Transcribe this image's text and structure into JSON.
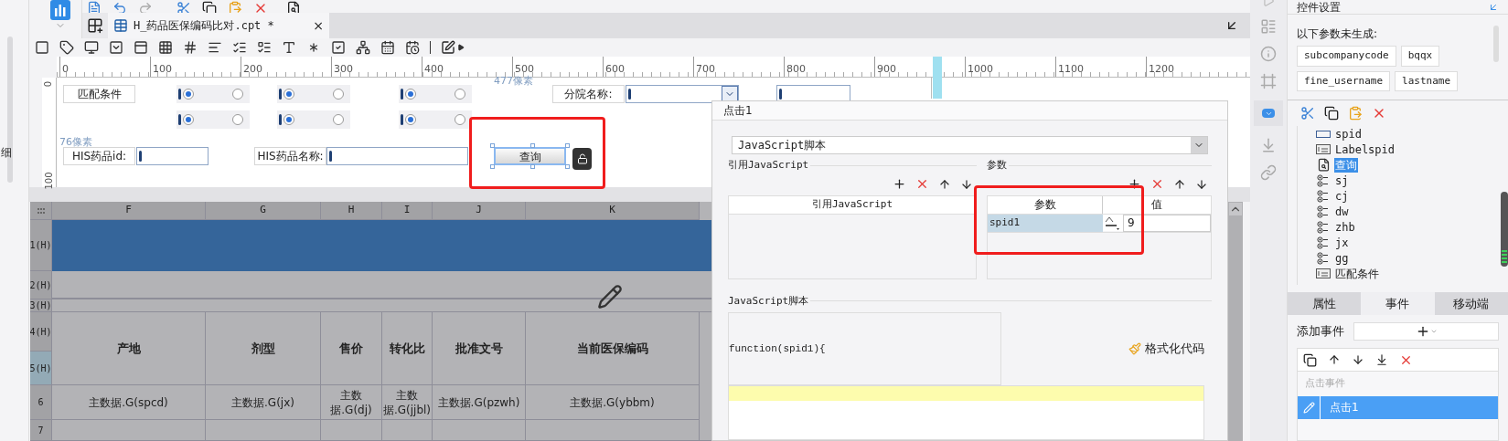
{
  "side": {
    "text": "细"
  },
  "editor_tab": {
    "title": "H_药品医保编码比对.cpt *",
    "close": "×"
  },
  "ruler": [
    "0",
    "100",
    "200",
    "300",
    "400",
    "500",
    "600",
    "700",
    "800",
    "900",
    "1000",
    "1100",
    "1200"
  ],
  "vruler": [
    "0",
    "100"
  ],
  "form_widgets": [
    {
      "kind": "label",
      "text": "匹配条件"
    },
    {
      "kind": "radio_group",
      "options": [
        {
          "selected": true
        },
        {
          "selected": false
        }
      ]
    },
    {
      "kind": "radio_group",
      "options": [
        {
          "selected": true
        },
        {
          "selected": false
        }
      ]
    },
    {
      "kind": "radio_group",
      "options": [
        {
          "selected": true
        },
        {
          "selected": false
        }
      ]
    },
    {
      "kind": "radio_group",
      "options": [
        {
          "selected": true
        },
        {
          "selected": false
        }
      ]
    },
    {
      "kind": "radio_group",
      "options": [
        {
          "selected": true
        },
        {
          "selected": false
        }
      ]
    },
    {
      "kind": "radio_group",
      "options": [
        {
          "selected": true
        },
        {
          "selected": false
        }
      ]
    },
    {
      "kind": "hint",
      "text": "477像素"
    },
    {
      "kind": "label",
      "text": "分院名称:"
    },
    {
      "kind": "combo"
    },
    {
      "kind": "input"
    },
    {
      "kind": "hint",
      "text": "76像素"
    },
    {
      "kind": "label",
      "text": "HIS药品id:"
    },
    {
      "kind": "input"
    },
    {
      "kind": "label",
      "text": "HIS药品名称:"
    },
    {
      "kind": "input"
    },
    {
      "kind": "button",
      "text": "查询",
      "selected": true
    }
  ],
  "sheet": {
    "columns": [
      "F",
      "G",
      "H",
      "I",
      "J",
      "K"
    ],
    "row_labels": [
      {
        "text": "1(H)",
        "selected": false
      },
      {
        "text": "2(H)",
        "selected": false
      },
      {
        "text": "3(H)",
        "selected": false
      },
      {
        "text": "4(H)",
        "selected": false
      },
      {
        "text": "5(H)",
        "selected": true
      },
      {
        "text": "6",
        "selected": false
      },
      {
        "text": "7",
        "selected": false
      }
    ],
    "header_cells": [
      "产地",
      "剂型",
      "售价",
      "转化比",
      "批准文号",
      "当前医保编码"
    ],
    "data_cells": [
      "主数据.G(spcd)",
      "主数据.G(jx)",
      "主数据.G(dj)",
      "主数据.G(jjbl)",
      "主数据.G(pzwh)",
      "主数据.G(ybbm)"
    ]
  },
  "dialog": {
    "title": "点击1",
    "script_type": "JavaScript脚本",
    "ref_section": "引用JavaScript",
    "param_section": "参数",
    "ref_header": "引用JavaScript",
    "param_columns": [
      "参数",
      "值"
    ],
    "params": [
      {
        "name": "spid1",
        "value": "9",
        "selected": true
      }
    ],
    "script_section": "JavaScript脚本",
    "code": "function(spid1){",
    "format_button": "格式化代码"
  },
  "panel": {
    "title": "控件设置",
    "missing_label": "以下参数未生成:",
    "params": [
      "subcompanycode",
      "bqqx",
      "fine_username",
      "lastname"
    ],
    "tree": [
      {
        "text": "spid",
        "kind": "input",
        "selected": false
      },
      {
        "text": "Labelspid",
        "kind": "label",
        "selected": false
      },
      {
        "text": "查询",
        "kind": "button",
        "selected": true
      },
      {
        "text": "sj",
        "kind": "radio",
        "selected": false
      },
      {
        "text": "cj",
        "kind": "radio",
        "selected": false
      },
      {
        "text": "dw",
        "kind": "radio",
        "selected": false
      },
      {
        "text": "zhb",
        "kind": "radio",
        "selected": false
      },
      {
        "text": "jx",
        "kind": "radio",
        "selected": false
      },
      {
        "text": "gg",
        "kind": "radio",
        "selected": false
      },
      {
        "text": "匹配条件",
        "kind": "label",
        "selected": false
      }
    ],
    "tabs": [
      {
        "label": "属性",
        "selected": false
      },
      {
        "label": "事件",
        "selected": true
      },
      {
        "label": "移动端",
        "selected": false
      }
    ],
    "add_event": "添加事件",
    "event_group": "点击事件",
    "events": [
      {
        "label": "点击1",
        "selected": true
      }
    ]
  }
}
